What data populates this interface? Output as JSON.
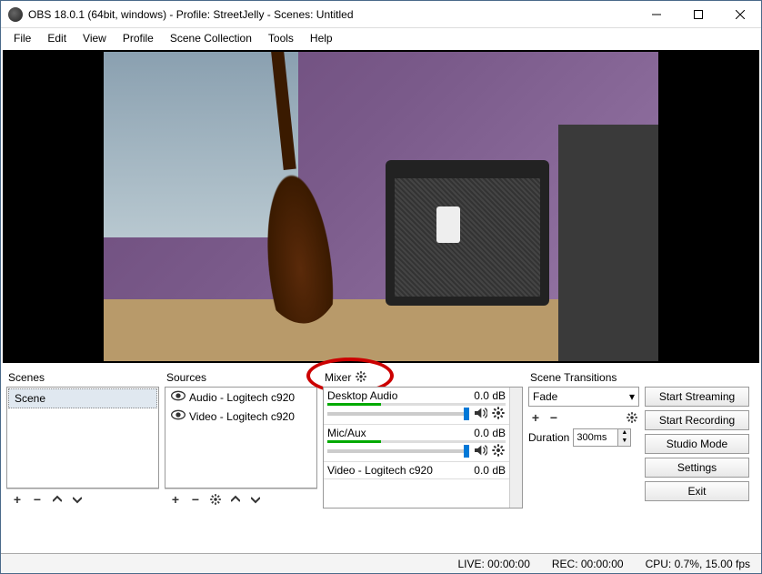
{
  "window": {
    "title": "OBS 18.0.1 (64bit, windows) - Profile: StreetJelly - Scenes: Untitled"
  },
  "menu": {
    "items": [
      "File",
      "Edit",
      "View",
      "Profile",
      "Scene Collection",
      "Tools",
      "Help"
    ]
  },
  "panels": {
    "scenes": {
      "title": "Scenes",
      "items": [
        "Scene"
      ]
    },
    "sources": {
      "title": "Sources",
      "items": [
        {
          "label": "Audio - Logitech c920"
        },
        {
          "label": "Video - Logitech c920"
        }
      ]
    },
    "mixer": {
      "title": "Mixer",
      "rows": [
        {
          "name": "Desktop Audio",
          "db": "0.0 dB"
        },
        {
          "name": "Mic/Aux",
          "db": "0.0 dB"
        },
        {
          "name": "Video - Logitech c920",
          "db": "0.0 dB"
        }
      ]
    },
    "transitions": {
      "title": "Scene Transitions",
      "selected": "Fade",
      "duration_label": "Duration",
      "duration_value": "300ms"
    }
  },
  "controls": {
    "start_streaming": "Start Streaming",
    "start_recording": "Start Recording",
    "studio_mode": "Studio Mode",
    "settings": "Settings",
    "exit": "Exit"
  },
  "status": {
    "live": "LIVE: 00:00:00",
    "rec": "REC: 00:00:00",
    "cpu": "CPU: 0.7%, 15.00 fps"
  },
  "annotation": {
    "target": "mixer-gear"
  }
}
